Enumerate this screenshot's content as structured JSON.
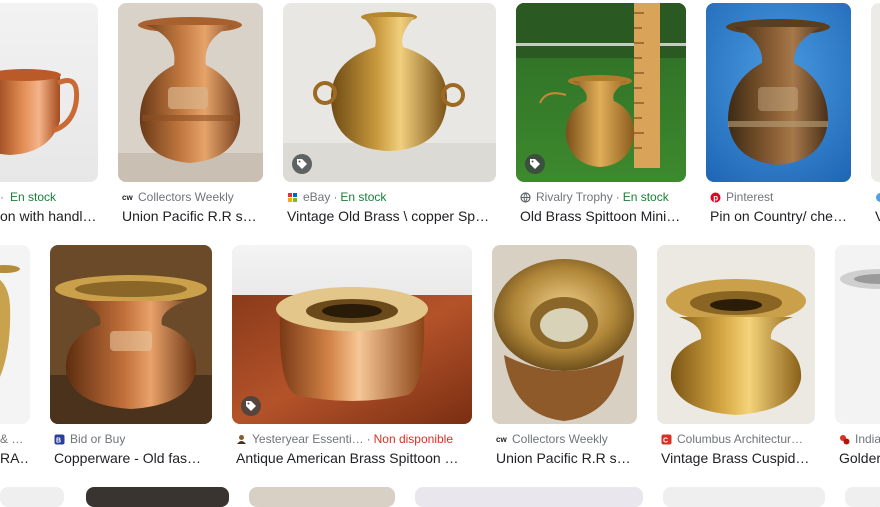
{
  "row1": [
    {
      "source": "",
      "badge": "En stock",
      "title": "on with handl…"
    },
    {
      "source": "Collectors Weekly",
      "badge": "",
      "title": "Union Pacific R.R s…"
    },
    {
      "source": "eBay",
      "badge": "En stock",
      "title": "Vintage Old Brass \\ copper Sp…"
    },
    {
      "source": "Rivalry Trophy",
      "badge": "En stock",
      "title": "Old Brass Spittoon Mini…"
    },
    {
      "source": "Pinterest",
      "badge": "",
      "title": "Pin on Country/ che…"
    },
    {
      "source": "",
      "badge": "",
      "title": "V"
    }
  ],
  "row2": [
    {
      "source": "& …",
      "badge": "",
      "title": "RA…"
    },
    {
      "source": "Bid or Buy",
      "badge": "",
      "title": "Copperware - Old fas…"
    },
    {
      "source": "Yesteryear Essenti…",
      "badge": "Non disponible",
      "title": "Antique American Brass Spittoon …"
    },
    {
      "source": "Collectors Weekly",
      "badge": "",
      "title": "Union Pacific R.R s…"
    },
    {
      "source": "Columbus Architectur…",
      "badge": "",
      "title": "Vintage Brass Cuspid…"
    },
    {
      "source": "India",
      "badge": "",
      "title": "Golder"
    }
  ],
  "colors": {
    "in_stock": "#188038",
    "unavailable": "#d93025",
    "source_text": "#70757a",
    "title_text": "#202124"
  },
  "icons": [
    "shopping-tag-icon",
    "favicon"
  ]
}
